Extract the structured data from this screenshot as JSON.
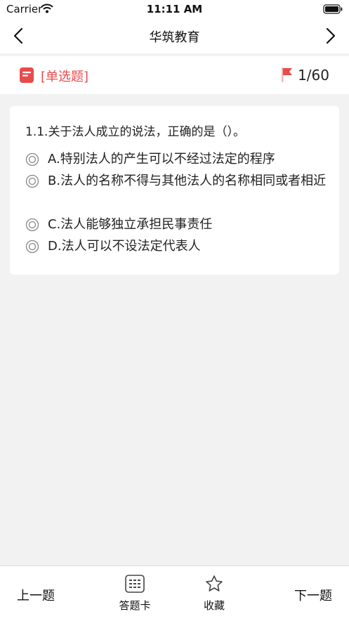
{
  "status_bar": {
    "carrier": "Carrier",
    "time": "11:11 AM"
  },
  "nav": {
    "title": "华筑教育",
    "back_icon": "chevron-left-icon",
    "next_icon": "chevron-right-icon"
  },
  "question_header": {
    "type_label": "[单选题]",
    "progress": "1/60",
    "accent_color": "#e94b4b"
  },
  "question": {
    "stem": "1.1.关于法人成立的说法，正确的是（）。",
    "options": [
      {
        "text": "A.特别法人的产生可以不经过法定的程序",
        "selected": false
      },
      {
        "text": "B.法人的名称不得与其他法人的名称相同或者相近",
        "selected": false
      },
      {
        "text": "C.法人能够独立承担民事责任",
        "selected": false
      },
      {
        "text": "D.法人可以不设法定代表人",
        "selected": false
      }
    ]
  },
  "toolbar": {
    "prev_label": "上一题",
    "answer_card_label": "答题卡",
    "favorite_label": "收藏",
    "next_label": "下一题"
  }
}
